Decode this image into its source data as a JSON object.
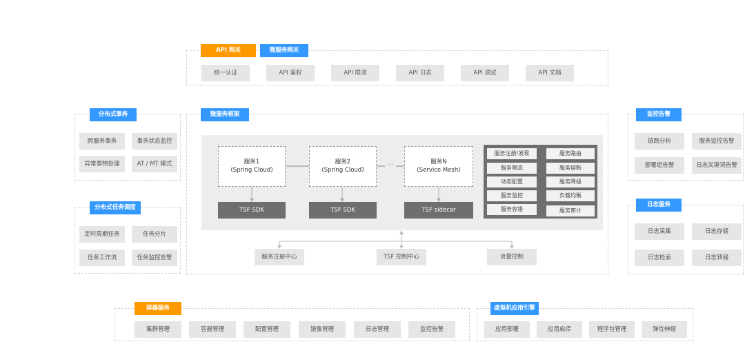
{
  "api_gateway": {
    "tag_api": "API 网关",
    "tag_micro": "微服务网关",
    "items": [
      "统一认证",
      "API 鉴权",
      "API 限流",
      "API 日志",
      "API 调试",
      "API 文档"
    ]
  },
  "distributed_tx": {
    "title": "分布式事务",
    "items": [
      "跨服务事务",
      "事务状态监控",
      "异常事物处理",
      "AT / MT 模式"
    ]
  },
  "task_sched": {
    "title": "分布式任务调度",
    "items": [
      "定时周期任务",
      "任务分片",
      "任务工作流",
      "任务监控告警"
    ]
  },
  "framework": {
    "title": "微服务框架",
    "services": [
      {
        "name": "服务1",
        "sub": "(Spring Cloud)"
      },
      {
        "name": "服务2",
        "sub": "(Spring Cloud)"
      },
      {
        "name": "服务N",
        "sub": "(Service Mesh)"
      }
    ],
    "ellipsis": "···",
    "sdk": [
      "TSF SDK",
      "TSF SDK",
      "TSF sidecar"
    ],
    "capabilities": [
      "服务注册/发现",
      "服务路由",
      "服务限流",
      "服务熔断",
      "动态配置",
      "服务降级",
      "服务监控",
      "负载均衡",
      "服务容错",
      "服务审计"
    ],
    "centers": [
      "服务注册中心",
      "TSF 控制中心",
      "流量控制"
    ]
  },
  "monitoring": {
    "title": "监控告警",
    "items": [
      "链路分析",
      "服务监控告警",
      "部署组告警",
      "日志关键词告警"
    ]
  },
  "log_service": {
    "title": "日志服务",
    "items": [
      "日志采集",
      "日志存储",
      "日志检索",
      "日志转储"
    ]
  },
  "container": {
    "title": "容器服务",
    "items": [
      "集群管理",
      "容器管理",
      "配置管理",
      "镜像管理",
      "日志管理",
      "监控告警"
    ]
  },
  "vm_engine": {
    "title": "虚拟机应用引擎",
    "items": [
      "应用部署",
      "应用启停",
      "程序包管理",
      "弹性伸缩"
    ]
  },
  "colors": {
    "orange": "#ff9900",
    "blue": "#3399ff",
    "dark_box": "#6e6e6e",
    "light_cell": "#e6e6e6"
  }
}
